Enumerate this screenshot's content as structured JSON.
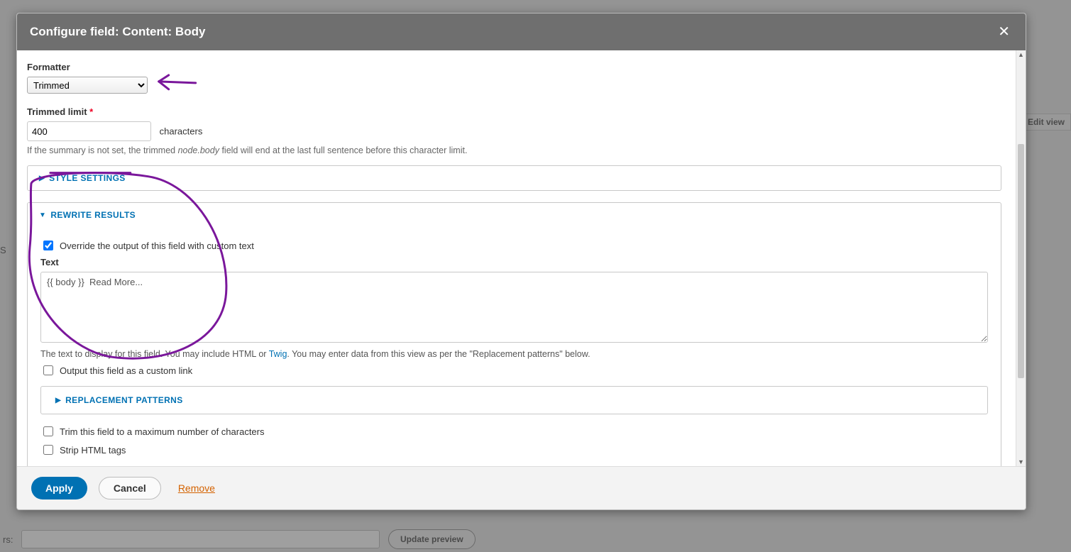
{
  "background": {
    "edit_view_btn": "Edit view",
    "preview_label": "rs:",
    "update_preview_btn": "Update preview",
    "side_text": "S"
  },
  "modal": {
    "title": "Configure field: Content: Body",
    "close_icon": "✕"
  },
  "formatter": {
    "label": "Formatter",
    "value": "Trimmed"
  },
  "trimmed": {
    "label": "Trimmed limit",
    "required": "*",
    "value": "400",
    "suffix": "characters",
    "help_prefix": "If the summary is not set, the trimmed ",
    "help_em": "node.body",
    "help_suffix": " field will end at the last full sentence before this character limit."
  },
  "style_settings": {
    "header": "STYLE SETTINGS"
  },
  "rewrite": {
    "header": "REWRITE RESULTS",
    "override_chk": "Override the output of this field with custom text",
    "override_checked": true,
    "text_label": "Text",
    "text_value": "{{ body }}  Read More...",
    "help_prefix": "The text to display for this field. You may include HTML or ",
    "help_link": "Twig",
    "help_suffix": ". You may enter data from this view as per the \"Replacement patterns\" below.",
    "custom_link_chk": "Output this field as a custom link",
    "custom_link_checked": false,
    "replacement_header": "REPLACEMENT PATTERNS",
    "trim_chk": "Trim this field to a maximum number of characters",
    "trim_checked": false,
    "strip_chk": "Strip HTML tags",
    "strip_checked": false
  },
  "footer": {
    "apply": "Apply",
    "cancel": "Cancel",
    "remove": "Remove"
  }
}
